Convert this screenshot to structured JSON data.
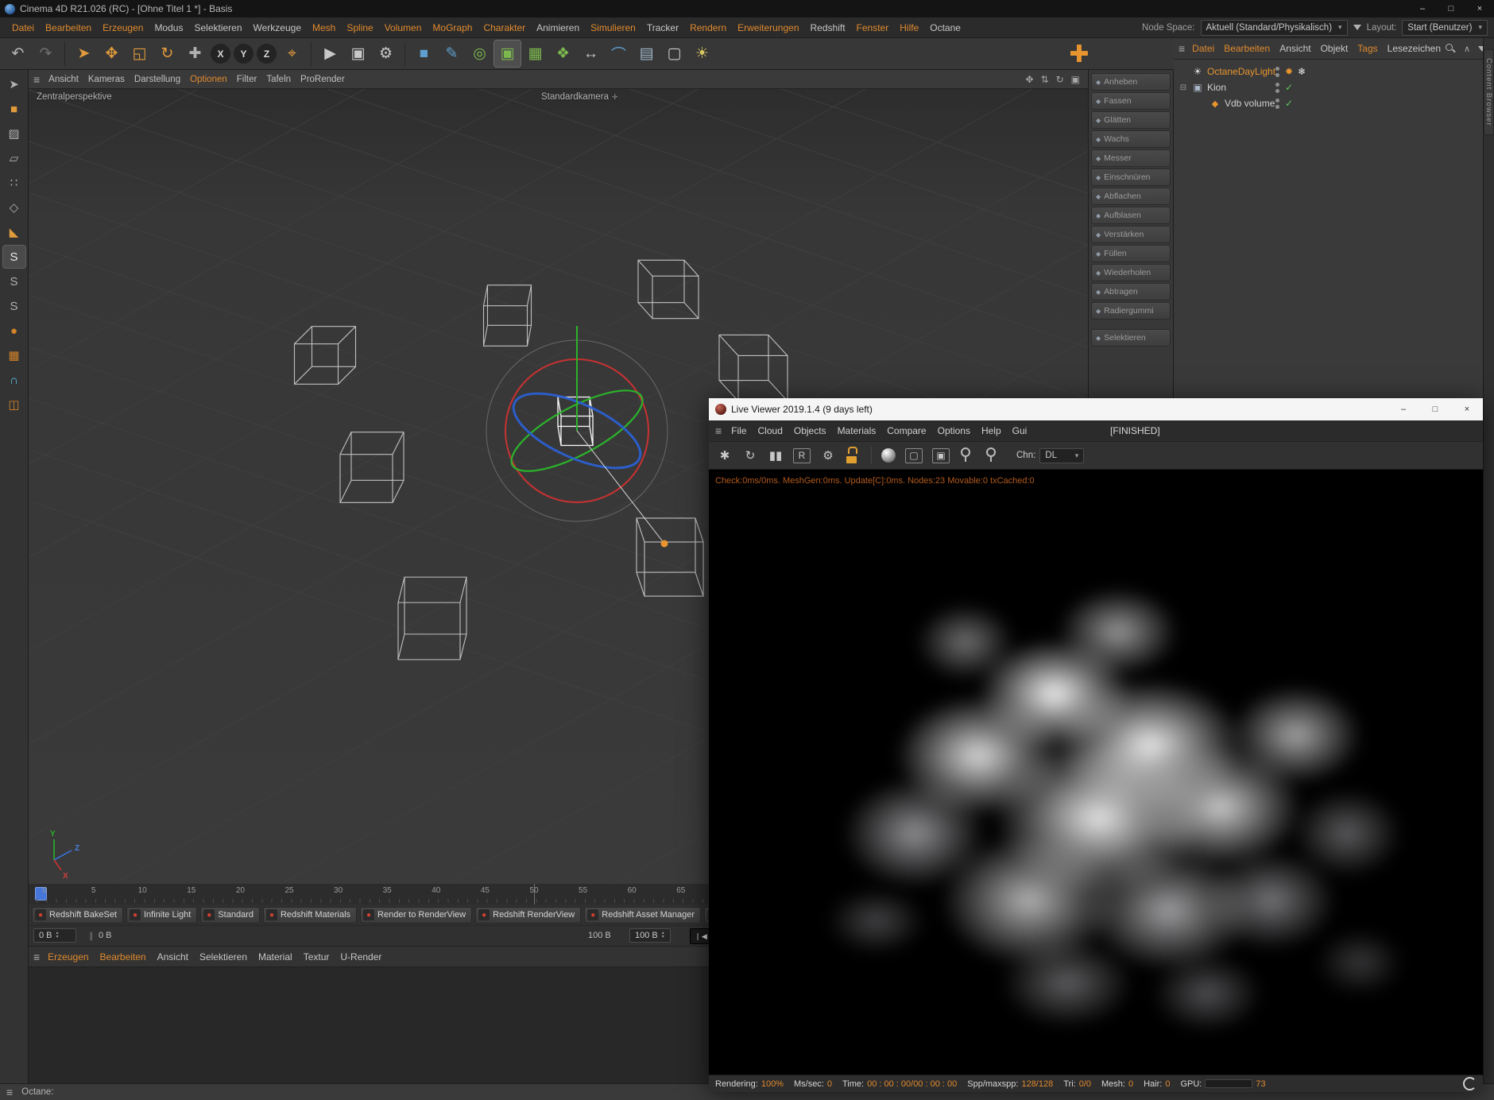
{
  "window": {
    "title": "Cinema 4D R21.026 (RC) - [Ohne Titel 1 *] - Basis"
  },
  "window_controls": {
    "minimize": "–",
    "maximize": "□",
    "close": "×"
  },
  "menubar": {
    "items": [
      {
        "label": "Datei",
        "hl": true
      },
      {
        "label": "Bearbeiten",
        "hl": true
      },
      {
        "label": "Erzeugen",
        "hl": true
      },
      {
        "label": "Modus",
        "hl": false
      },
      {
        "label": "Selektieren",
        "hl": false
      },
      {
        "label": "Werkzeuge",
        "hl": false
      },
      {
        "label": "Mesh",
        "hl": true
      },
      {
        "label": "Spline",
        "hl": true
      },
      {
        "label": "Volumen",
        "hl": true
      },
      {
        "label": "MoGraph",
        "hl": true
      },
      {
        "label": "Charakter",
        "hl": true
      },
      {
        "label": "Animieren",
        "hl": false
      },
      {
        "label": "Simulieren",
        "hl": true
      },
      {
        "label": "Tracker",
        "hl": false
      },
      {
        "label": "Rendern",
        "hl": true
      },
      {
        "label": "Erweiterungen",
        "hl": true
      },
      {
        "label": "Redshift",
        "hl": false
      },
      {
        "label": "Fenster",
        "hl": true
      },
      {
        "label": "Hilfe",
        "hl": true
      },
      {
        "label": "Octane",
        "hl": false
      }
    ]
  },
  "nodespace": {
    "label": "Node Space:",
    "value": "Aktuell (Standard/Physikalisch)",
    "layout_label": "Layout:",
    "layout_value": "Start (Benutzer)"
  },
  "toolbar": {
    "icons": [
      {
        "name": "undo-icon",
        "glyph": "↶",
        "color": "#b8b8b8"
      },
      {
        "name": "redo-icon",
        "glyph": "↷",
        "color": "#6f6f6f"
      },
      {
        "sep": true
      },
      {
        "name": "live-selection-icon",
        "glyph": "➤",
        "color": "#e09a3c"
      },
      {
        "name": "move-icon",
        "glyph": "✥",
        "color": "#e09a3c"
      },
      {
        "name": "scale-icon",
        "glyph": "◱",
        "color": "#e09a3c"
      },
      {
        "name": "rotate-icon",
        "glyph": "↻",
        "color": "#e09a3c"
      },
      {
        "name": "psr-tools-icon",
        "glyph": "✚",
        "color": "#b0b0b0"
      },
      {
        "name": "axis-x-lock-icon",
        "glyph": "X",
        "color": "#d8d8d8",
        "circle": true
      },
      {
        "name": "axis-y-lock-icon",
        "glyph": "Y",
        "color": "#d8d8d8",
        "circle": true
      },
      {
        "name": "axis-z-lock-icon",
        "glyph": "Z",
        "color": "#d8d8d8",
        "circle": true
      },
      {
        "name": "coordinate-system-icon",
        "glyph": "⌖",
        "color": "#e09a3c"
      },
      {
        "sep": true
      },
      {
        "name": "render-view-icon",
        "glyph": "▶",
        "color": "#c8c8c8"
      },
      {
        "name": "render-picture-viewer-icon",
        "glyph": "▣",
        "color": "#c8c8c8"
      },
      {
        "name": "render-settings-icon",
        "glyph": "⚙",
        "color": "#c8c8c8"
      },
      {
        "sep": true
      },
      {
        "name": "add-cube-icon",
        "glyph": "■",
        "color": "#5f9fd0"
      },
      {
        "name": "spline-pen-icon",
        "glyph": "✎",
        "color": "#5f9fd0"
      },
      {
        "name": "mograph-icon",
        "glyph": "◎",
        "color": "#7cb84e"
      },
      {
        "name": "cloner-icon",
        "glyph": "▣",
        "color": "#7cb84e",
        "active": true
      },
      {
        "name": "volume-icon",
        "glyph": "▦",
        "color": "#7cb84e"
      },
      {
        "name": "field-icon",
        "glyph": "❖",
        "color": "#7cb84e"
      },
      {
        "name": "array-icon",
        "glyph": "↔",
        "color": "#c8c8c8"
      },
      {
        "name": "deformer-icon",
        "glyph": "⌒",
        "color": "#5f9fd0"
      },
      {
        "name": "floor-icon",
        "glyph": "▤",
        "color": "#9fb6c8"
      },
      {
        "name": "camera-icon",
        "glyph": "▢",
        "color": "#c8c8c8"
      },
      {
        "name": "light-icon",
        "glyph": "☀",
        "color": "#d8c860"
      }
    ]
  },
  "left_toolbar": {
    "icons": [
      {
        "name": "pointer-tool-icon",
        "glyph": "➤",
        "color": "#b0b0b0"
      },
      {
        "name": "model-mode-icon",
        "glyph": "■",
        "color": "#e09a3c"
      },
      {
        "name": "texture-mode-icon",
        "glyph": "▨",
        "color": "#b0b0b0"
      },
      {
        "name": "workplane-mode-icon",
        "glyph": "▱",
        "color": "#b0b0b0"
      },
      {
        "name": "points-mode-icon",
        "glyph": "∷",
        "color": "#b0b0b0"
      },
      {
        "name": "edges-mode-icon",
        "glyph": "◇",
        "color": "#b0b0b0"
      },
      {
        "name": "polygons-mode-icon",
        "glyph": "◣",
        "color": "#e09a3c"
      },
      {
        "name": "enable-snap-icon",
        "glyph": "S",
        "color": "#e8e8e8",
        "active": true
      },
      {
        "name": "snap-settings-icon",
        "glyph": "S",
        "color": "#b0b0b0"
      },
      {
        "name": "snap-3d-icon",
        "glyph": "S",
        "color": "#b0b0b0"
      },
      {
        "name": "paint-tool-icon",
        "glyph": "●",
        "color": "#d4822a"
      },
      {
        "name": "array-tool-icon",
        "glyph": "▦",
        "color": "#d4822a"
      },
      {
        "name": "magnet-tool-icon",
        "glyph": "∩",
        "color": "#58c0e8"
      },
      {
        "name": "mirror-tool-icon",
        "glyph": "◫",
        "color": "#d4822a"
      }
    ]
  },
  "viewport": {
    "label": "Zentralperspektive",
    "camera_label": "Standardkamera",
    "axis_labels": {
      "x": "X",
      "y": "Y",
      "z": "Z"
    },
    "menu": [
      {
        "label": "Ansicht",
        "hl": false
      },
      {
        "label": "Kameras",
        "hl": false
      },
      {
        "label": "Darstellung",
        "hl": false
      },
      {
        "label": "Optionen",
        "hl": true
      },
      {
        "label": "Filter",
        "hl": false
      },
      {
        "label": "Tafeln",
        "hl": false
      },
      {
        "label": "ProRender",
        "hl": false
      }
    ],
    "corner_icons": [
      {
        "name": "viewport-pan-icon",
        "glyph": "✥"
      },
      {
        "name": "viewport-sync-icon",
        "glyph": "⇅"
      },
      {
        "name": "viewport-refresh-icon",
        "glyph": "↻"
      },
      {
        "name": "viewport-toggle-icon",
        "glyph": "▣"
      }
    ]
  },
  "sculpt_tools": {
    "items": [
      "Anheben",
      "Fassen",
      "Glätten",
      "Wachs",
      "Messer",
      "Einschnüren",
      "Abflachen",
      "Aufblasen",
      "Verstärken",
      "Füllen",
      "Wiederholen",
      "Abtragen",
      "Radiergummi",
      "Selektieren"
    ]
  },
  "object_manager": {
    "menu": [
      {
        "label": "Datei",
        "hl": true
      },
      {
        "label": "Bearbeiten",
        "hl": true
      },
      {
        "label": "Ansicht",
        "hl": false
      },
      {
        "label": "Objekt",
        "hl": false
      },
      {
        "label": "Tags",
        "hl": true
      },
      {
        "label": "Lesezeichen",
        "hl": false
      }
    ],
    "corner_icons": [
      {
        "name": "om-search-icon",
        "kind": "search"
      },
      {
        "name": "om-up-icon",
        "kind": "glyph",
        "glyph": "∧"
      },
      {
        "name": "om-filter-icon",
        "kind": "funnel"
      },
      {
        "name": "om-caret-icon",
        "kind": "glyph",
        "glyph": "▾"
      }
    ],
    "tree": [
      {
        "label": "OctaneDayLight",
        "color": "orange",
        "icon": "sun",
        "expander": false,
        "indent": 0,
        "tags": [
          "dots",
          "sun",
          "snow"
        ]
      },
      {
        "label": "Kion",
        "icon": "null",
        "expander": true,
        "indent": 0,
        "tags": [
          "dots",
          "check"
        ]
      },
      {
        "label": "Vdb volume",
        "icon": "vdb",
        "expander": false,
        "indent": 1,
        "tags": [
          "dots",
          "check"
        ]
      }
    ]
  },
  "right_dock_tabs": [
    "Content Browser"
  ],
  "timeline": {
    "ticks": [
      "0",
      "5",
      "10",
      "15",
      "20",
      "25",
      "30",
      "35",
      "40",
      "45",
      "50",
      "55",
      "60",
      "65"
    ]
  },
  "script_buttons": [
    {
      "label": "Redshift BakeSet"
    },
    {
      "label": "Infinite Light"
    },
    {
      "label": "Standard"
    },
    {
      "label": "Redshift Materials"
    },
    {
      "label": "Render to RenderView"
    },
    {
      "label": "Redshift RenderView"
    },
    {
      "label": "Redshift Asset Manager"
    },
    {
      "label": ""
    }
  ],
  "memory": {
    "value_a": "0 B",
    "value_b": "0 B",
    "value_c": "100 B",
    "value_d": "100 B"
  },
  "material_menu": [
    {
      "label": "Erzeugen",
      "hl": true
    },
    {
      "label": "Bearbeiten",
      "hl": true
    },
    {
      "label": "Ansicht",
      "hl": false
    },
    {
      "label": "Selektieren",
      "hl": false
    },
    {
      "label": "Material",
      "hl": false
    },
    {
      "label": "Textur",
      "hl": false
    },
    {
      "label": "U-Render",
      "hl": false
    }
  ],
  "statusbar": {
    "text": "Octane:"
  },
  "colors": {
    "accent": "#e8952f",
    "status_orange": "#e0882e",
    "check_green": "#58c858",
    "axis_red": "#c83232",
    "axis_green": "#2bb32b",
    "axis_blue": "#2b5fd0"
  },
  "live_viewer": {
    "title": "Live Viewer 2019.1.4 (9 days left)",
    "menu": [
      {
        "label": "File"
      },
      {
        "label": "Cloud"
      },
      {
        "label": "Objects"
      },
      {
        "label": "Materials"
      },
      {
        "label": "Compare"
      },
      {
        "label": "Options"
      },
      {
        "label": "Help"
      },
      {
        "label": "Gui"
      }
    ],
    "finished_label": "[FINISHED]",
    "toolbar_icons": [
      {
        "name": "restart-render-icon",
        "kind": "glyph",
        "glyph": "✱"
      },
      {
        "name": "refresh-icon",
        "kind": "glyph",
        "glyph": "↻"
      },
      {
        "name": "pause-icon",
        "kind": "glyph",
        "glyph": "▮▮"
      },
      {
        "name": "render-priority-icon",
        "kind": "glyph",
        "glyph": "R",
        "boxed": true
      },
      {
        "name": "settings-gear-icon",
        "kind": "glyph",
        "glyph": "⚙"
      },
      {
        "name": "lock-resolution-icon",
        "kind": "lock"
      },
      {
        "kind": "sep"
      },
      {
        "name": "material-picker-icon",
        "kind": "sphere"
      },
      {
        "name": "render-region-icon",
        "kind": "glyph",
        "glyph": "▢",
        "boxed": true
      },
      {
        "name": "film-region-icon",
        "kind": "glyph",
        "glyph": "▣",
        "boxed": true
      },
      {
        "name": "focus-picker-icon",
        "kind": "pin"
      },
      {
        "name": "white-balance-picker-icon",
        "kind": "pin"
      }
    ],
    "chn": {
      "label": "Chn:",
      "value": "DL"
    },
    "status_line": "Check:0ms/0ms. MeshGen:0ms. Update[C]:0ms. Nodes:23 Movable:0 txCached:0",
    "footer": {
      "stats": [
        {
          "label": "Rendering:",
          "value": "100%"
        },
        {
          "label": "Ms/sec:",
          "value": "0"
        },
        {
          "label": "Time:",
          "value": "00 : 00 : 00/00 : 00 : 00"
        },
        {
          "label": "Spp/maxspp:",
          "value": "128/128"
        },
        {
          "label": "Tri:",
          "value": "0/0"
        },
        {
          "label": "Mesh:",
          "value": "0"
        },
        {
          "label": "Hair:",
          "value": "0"
        },
        {
          "label": "GPU:",
          "value": "73",
          "bar": true
        }
      ]
    }
  }
}
